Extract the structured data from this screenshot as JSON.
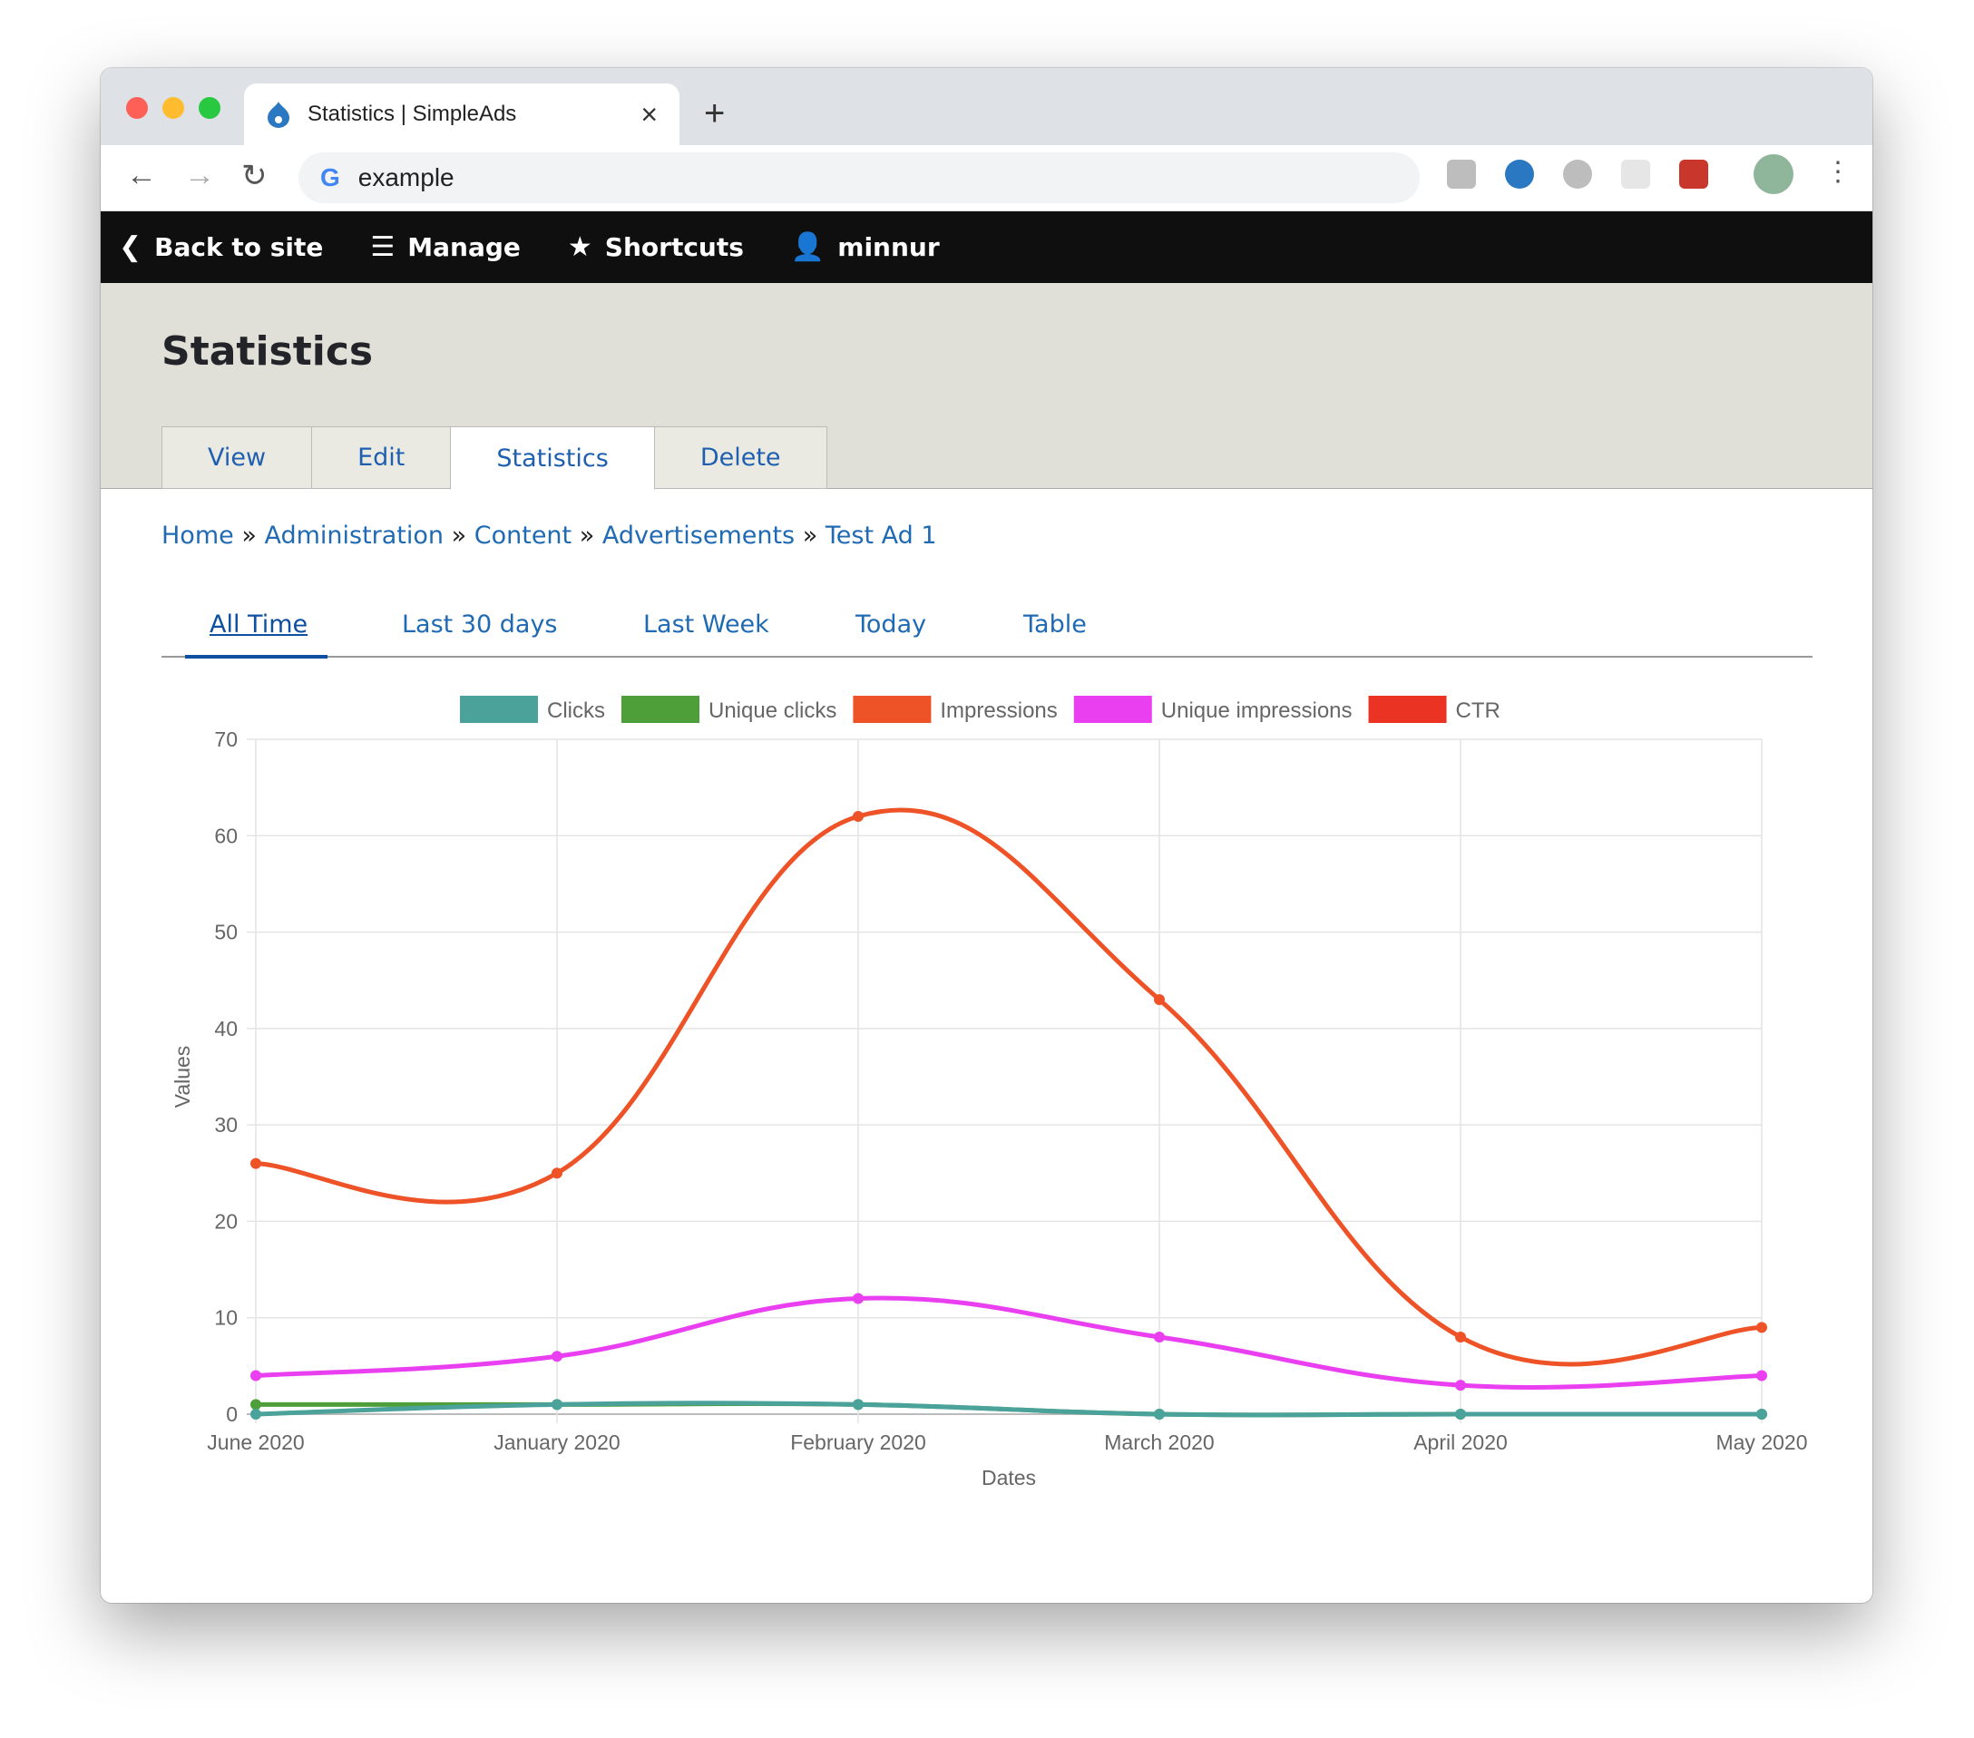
{
  "browser": {
    "tab_title": "Statistics | SimpleAds",
    "address": "example",
    "new_tab": "+",
    "close": "×"
  },
  "toolbar": {
    "back": "Back to site",
    "manage": "Manage",
    "shortcuts": "Shortcuts",
    "user": "minnur"
  },
  "page": {
    "title": "Statistics",
    "tabs": [
      {
        "label": "View"
      },
      {
        "label": "Edit"
      },
      {
        "label": "Statistics",
        "active": true
      },
      {
        "label": "Delete"
      }
    ]
  },
  "breadcrumb": [
    "Home",
    "Administration",
    "Content",
    "Advertisements",
    "Test Ad 1"
  ],
  "breadcrumb_sep": "»",
  "subtabs": [
    {
      "label": "All Time",
      "active": true
    },
    {
      "label": "Last 30 days"
    },
    {
      "label": "Last Week"
    },
    {
      "label": "Today"
    },
    {
      "label": "Table"
    }
  ],
  "chart_data": {
    "type": "line",
    "xlabel": "Dates",
    "ylabel": "Values",
    "ylim": [
      0,
      70
    ],
    "yticks": [
      0,
      10,
      20,
      30,
      40,
      50,
      60,
      70
    ],
    "categories": [
      "June 2020",
      "January 2020",
      "February 2020",
      "March 2020",
      "April 2020",
      "May 2020"
    ],
    "legend": "top",
    "grid": true,
    "series": [
      {
        "name": "Clicks",
        "color": "#4aa29b",
        "values": [
          0,
          1,
          1,
          0,
          0,
          0
        ]
      },
      {
        "name": "Unique clicks",
        "color": "#4e9e3a",
        "values": [
          1,
          1,
          1,
          0,
          0,
          0
        ]
      },
      {
        "name": "Impressions",
        "color": "#ee5328",
        "values": [
          26,
          25,
          62,
          43,
          8,
          9
        ]
      },
      {
        "name": "Unique impressions",
        "color": "#e93ff0",
        "values": [
          4,
          6,
          12,
          8,
          3,
          4
        ]
      },
      {
        "name": "CTR",
        "color": "#ea3323",
        "values": []
      }
    ]
  }
}
